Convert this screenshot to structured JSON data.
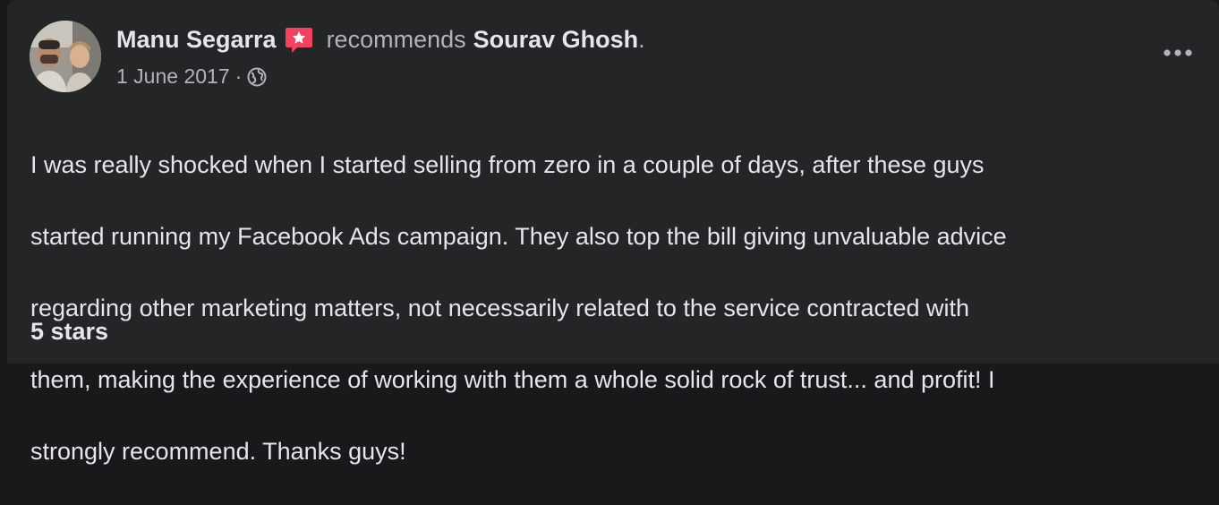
{
  "post": {
    "author": "Manu Segarra",
    "verb": "recommends",
    "target": "Sourav Ghosh",
    "period": ".",
    "date": "1 June 2017",
    "separator": "·",
    "audience_icon": "globe-icon",
    "recommend_icon": "pink-star-speech-bubble-icon",
    "more_icon": "ellipsis-icon",
    "body_lines": [
      "I was really shocked when I started selling from zero in a couple of days, after these guys",
      "started running my Facebook Ads campaign. They also top the bill giving unvaluable advice",
      "regarding other marketing matters, not necessarily related to the service contracted with",
      "them, making the experience of working with them a whole solid rock of trust... and profit! I",
      "strongly recommend. Thanks guys!"
    ],
    "rating": "5 stars"
  },
  "colors": {
    "background": "#18191a",
    "card": "#242526",
    "primary_text": "#e4e6eb",
    "secondary_text": "#b0b3b8",
    "recommend_accent": "#f3425f"
  }
}
